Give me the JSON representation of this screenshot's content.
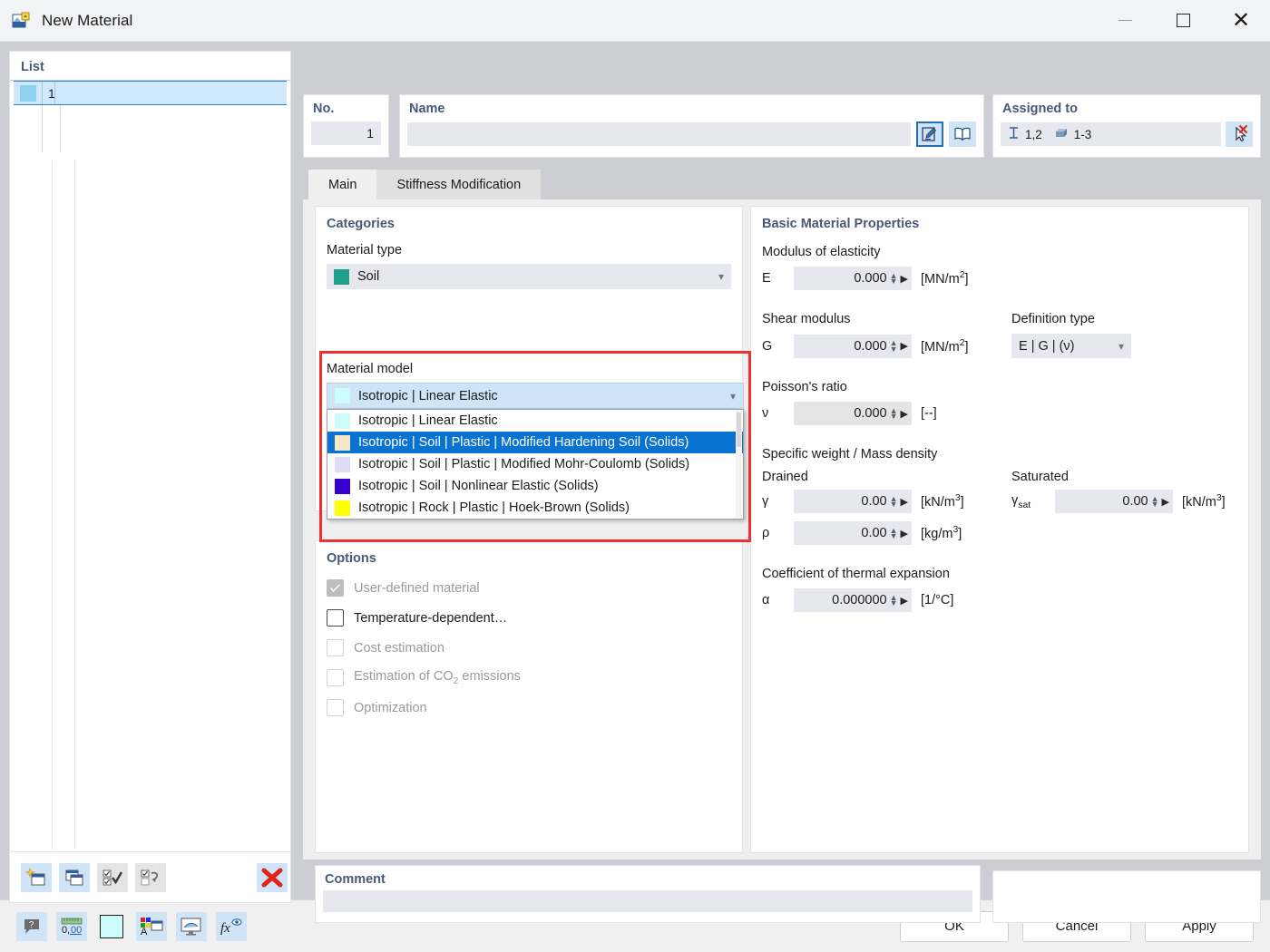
{
  "window": {
    "title": "New Material",
    "icon": "material-icon",
    "minimize": "minimize-icon",
    "maximize": "maximize-icon",
    "close": "close-icon"
  },
  "list_panel": {
    "caption": "List",
    "rows": [
      {
        "no": "1",
        "color": "#8ed2f0",
        "name": ""
      }
    ],
    "toolbar": [
      {
        "name": "new-material-button",
        "icon": "new-window-star-icon"
      },
      {
        "name": "copy-material-button",
        "icon": "copy-windows-icon"
      },
      {
        "name": "select-all-button",
        "icon": "check-all-icon"
      },
      {
        "name": "invert-selection-button",
        "icon": "invert-selection-icon"
      },
      {
        "name": "delete-material-button",
        "icon": "red-x-icon"
      }
    ]
  },
  "no_panel": {
    "caption": "No.",
    "value": "1"
  },
  "name_panel": {
    "caption": "Name",
    "value": "",
    "placeholder": "",
    "edit_icon": "edit-pencil-icon",
    "library_icon": "book-library-icon"
  },
  "assigned_panel": {
    "caption": "Assigned to",
    "members_icon": "i-beam-member-icon",
    "members_value": "1,2",
    "solids_icon": "solid-block-icon",
    "solids_value": "1-3",
    "pick_icon": "pick-cursor-deselect-icon"
  },
  "tabs": [
    {
      "label": "Main",
      "active": true
    },
    {
      "label": "Stiffness Modification",
      "active": false
    }
  ],
  "categories": {
    "caption": "Categories",
    "material_type_label": "Material type",
    "material_type_value": "Soil",
    "material_type_color": "#1fa08c",
    "material_model_label": "Material model",
    "material_model_value": "Isotropic | Linear Elastic",
    "material_model_color": "#ccfbfb",
    "material_model_options": [
      {
        "label": "Isotropic | Linear Elastic",
        "color": "#ccfbfb",
        "selected": false
      },
      {
        "label": "Isotropic | Soil | Plastic | Modified Hardening Soil (Solids)",
        "color": "#f7e7c8",
        "selected": true
      },
      {
        "label": "Isotropic | Soil | Plastic | Modified Mohr-Coulomb (Solids)",
        "color": "#e0dcf7",
        "selected": false
      },
      {
        "label": "Isotropic | Soil | Nonlinear Elastic (Solids)",
        "color": "#3300cc",
        "selected": false
      },
      {
        "label": "Isotropic | Rock | Plastic | Hoek-Brown (Solids)",
        "color": "#ffff00",
        "selected": false
      }
    ],
    "highlight_color": "#f03030"
  },
  "options": {
    "caption": "Options",
    "items": [
      {
        "label": "User-defined material",
        "checked": true,
        "enabled": false
      },
      {
        "label": "Temperature-dependent…",
        "checked": false,
        "enabled": true
      },
      {
        "label": "Cost estimation",
        "checked": false,
        "enabled": false
      },
      {
        "label": "Estimation of CO2 emissions",
        "checked": false,
        "enabled": false
      },
      {
        "label": "Optimization",
        "checked": false,
        "enabled": false
      }
    ]
  },
  "properties": {
    "caption": "Basic Material Properties",
    "modulus_group": "Modulus of elasticity",
    "E": {
      "symbol": "E",
      "value": "0.000",
      "unit": "[MN/m2]"
    },
    "shear_group": "Shear modulus",
    "G": {
      "symbol": "G",
      "value": "0.000",
      "unit": "[MN/m2]"
    },
    "definition_type_label": "Definition type",
    "definition_type_value": "E | G | (ν)",
    "poisson_group": "Poisson's ratio",
    "nu": {
      "symbol": "ν",
      "value": "0.000",
      "unit": "[--]"
    },
    "weight_group": "Specific weight / Mass density",
    "drained_label": "Drained",
    "saturated_label": "Saturated",
    "gamma": {
      "symbol": "γ",
      "value": "0.00",
      "unit": "[kN/m3]"
    },
    "rho": {
      "symbol": "ρ",
      "value": "0.00",
      "unit": "[kg/m3]"
    },
    "gamma_sat": {
      "symbol": "γsat",
      "value": "0.00",
      "unit": "[kN/m3]"
    },
    "thermal_group": "Coefficient of thermal expansion",
    "alpha": {
      "symbol": "α",
      "value": "0.000000",
      "unit": "[1/°C]"
    }
  },
  "comment": {
    "caption": "Comment",
    "value": ""
  },
  "bottom_bar": {
    "icons": [
      {
        "name": "help-icon"
      },
      {
        "name": "decimal-places-icon"
      },
      {
        "name": "color-swatch-icon",
        "color": "#ccfbfb"
      },
      {
        "name": "color-legend-icon"
      },
      {
        "name": "rendering-icon"
      },
      {
        "name": "formula-icon"
      }
    ],
    "ok_label": "OK",
    "cancel_label": "Cancel",
    "apply_label": "Apply"
  }
}
